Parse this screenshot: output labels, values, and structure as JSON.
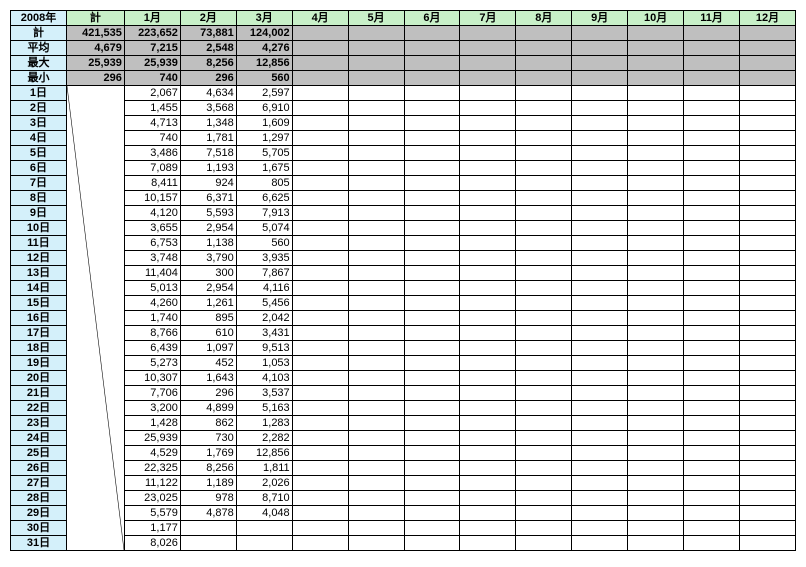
{
  "year_label": "2008年",
  "total_label": "計",
  "months": [
    "1月",
    "2月",
    "3月",
    "4月",
    "5月",
    "6月",
    "7月",
    "8月",
    "9月",
    "10月",
    "11月",
    "12月"
  ],
  "summary_rows": [
    {
      "label": "計",
      "total": "421,535",
      "cells": [
        "223,652",
        "73,881",
        "124,002",
        "",
        "",
        "",
        "",
        "",
        "",
        "",
        "",
        ""
      ]
    },
    {
      "label": "平均",
      "total": "4,679",
      "cells": [
        "7,215",
        "2,548",
        "4,276",
        "",
        "",
        "",
        "",
        "",
        "",
        "",
        "",
        ""
      ]
    },
    {
      "label": "最大",
      "total": "25,939",
      "cells": [
        "25,939",
        "8,256",
        "12,856",
        "",
        "",
        "",
        "",
        "",
        "",
        "",
        "",
        ""
      ]
    },
    {
      "label": "最小",
      "total": "296",
      "cells": [
        "740",
        "296",
        "560",
        "",
        "",
        "",
        "",
        "",
        "",
        "",
        "",
        ""
      ]
    }
  ],
  "day_rows": [
    {
      "label": "1日",
      "cells": [
        "2,067",
        "4,634",
        "2,597",
        "",
        "",
        "",
        "",
        "",
        "",
        "",
        "",
        ""
      ]
    },
    {
      "label": "2日",
      "cells": [
        "1,455",
        "3,568",
        "6,910",
        "",
        "",
        "",
        "",
        "",
        "",
        "",
        "",
        ""
      ]
    },
    {
      "label": "3日",
      "cells": [
        "4,713",
        "1,348",
        "1,609",
        "",
        "",
        "",
        "",
        "",
        "",
        "",
        "",
        ""
      ]
    },
    {
      "label": "4日",
      "cells": [
        "740",
        "1,781",
        "1,297",
        "",
        "",
        "",
        "",
        "",
        "",
        "",
        "",
        ""
      ]
    },
    {
      "label": "5日",
      "cells": [
        "3,486",
        "7,518",
        "5,705",
        "",
        "",
        "",
        "",
        "",
        "",
        "",
        "",
        ""
      ]
    },
    {
      "label": "6日",
      "cells": [
        "7,089",
        "1,193",
        "1,675",
        "",
        "",
        "",
        "",
        "",
        "",
        "",
        "",
        ""
      ]
    },
    {
      "label": "7日",
      "cells": [
        "8,411",
        "924",
        "805",
        "",
        "",
        "",
        "",
        "",
        "",
        "",
        "",
        ""
      ]
    },
    {
      "label": "8日",
      "cells": [
        "10,157",
        "6,371",
        "6,625",
        "",
        "",
        "",
        "",
        "",
        "",
        "",
        "",
        ""
      ]
    },
    {
      "label": "9日",
      "cells": [
        "4,120",
        "5,593",
        "7,913",
        "",
        "",
        "",
        "",
        "",
        "",
        "",
        "",
        ""
      ]
    },
    {
      "label": "10日",
      "cells": [
        "3,655",
        "2,954",
        "5,074",
        "",
        "",
        "",
        "",
        "",
        "",
        "",
        "",
        ""
      ]
    },
    {
      "label": "11日",
      "cells": [
        "6,753",
        "1,138",
        "560",
        "",
        "",
        "",
        "",
        "",
        "",
        "",
        "",
        ""
      ]
    },
    {
      "label": "12日",
      "cells": [
        "3,748",
        "3,790",
        "3,935",
        "",
        "",
        "",
        "",
        "",
        "",
        "",
        "",
        ""
      ]
    },
    {
      "label": "13日",
      "cells": [
        "11,404",
        "300",
        "7,867",
        "",
        "",
        "",
        "",
        "",
        "",
        "",
        "",
        ""
      ]
    },
    {
      "label": "14日",
      "cells": [
        "5,013",
        "2,954",
        "4,116",
        "",
        "",
        "",
        "",
        "",
        "",
        "",
        "",
        ""
      ]
    },
    {
      "label": "15日",
      "cells": [
        "4,260",
        "1,261",
        "5,456",
        "",
        "",
        "",
        "",
        "",
        "",
        "",
        "",
        ""
      ]
    },
    {
      "label": "16日",
      "cells": [
        "1,740",
        "895",
        "2,042",
        "",
        "",
        "",
        "",
        "",
        "",
        "",
        "",
        ""
      ]
    },
    {
      "label": "17日",
      "cells": [
        "8,766",
        "610",
        "3,431",
        "",
        "",
        "",
        "",
        "",
        "",
        "",
        "",
        ""
      ]
    },
    {
      "label": "18日",
      "cells": [
        "6,439",
        "1,097",
        "9,513",
        "",
        "",
        "",
        "",
        "",
        "",
        "",
        "",
        ""
      ]
    },
    {
      "label": "19日",
      "cells": [
        "5,273",
        "452",
        "1,053",
        "",
        "",
        "",
        "",
        "",
        "",
        "",
        "",
        ""
      ]
    },
    {
      "label": "20日",
      "cells": [
        "10,307",
        "1,643",
        "4,103",
        "",
        "",
        "",
        "",
        "",
        "",
        "",
        "",
        ""
      ]
    },
    {
      "label": "21日",
      "cells": [
        "7,706",
        "296",
        "3,537",
        "",
        "",
        "",
        "",
        "",
        "",
        "",
        "",
        ""
      ]
    },
    {
      "label": "22日",
      "cells": [
        "3,200",
        "4,899",
        "5,163",
        "",
        "",
        "",
        "",
        "",
        "",
        "",
        "",
        ""
      ]
    },
    {
      "label": "23日",
      "cells": [
        "1,428",
        "862",
        "1,283",
        "",
        "",
        "",
        "",
        "",
        "",
        "",
        "",
        ""
      ]
    },
    {
      "label": "24日",
      "cells": [
        "25,939",
        "730",
        "2,282",
        "",
        "",
        "",
        "",
        "",
        "",
        "",
        "",
        ""
      ]
    },
    {
      "label": "25日",
      "cells": [
        "4,529",
        "1,769",
        "12,856",
        "",
        "",
        "",
        "",
        "",
        "",
        "",
        "",
        ""
      ]
    },
    {
      "label": "26日",
      "cells": [
        "22,325",
        "8,256",
        "1,811",
        "",
        "",
        "",
        "",
        "",
        "",
        "",
        "",
        ""
      ]
    },
    {
      "label": "27日",
      "cells": [
        "11,122",
        "1,189",
        "2,026",
        "",
        "",
        "",
        "",
        "",
        "",
        "",
        "",
        ""
      ]
    },
    {
      "label": "28日",
      "cells": [
        "23,025",
        "978",
        "8,710",
        "",
        "",
        "",
        "",
        "",
        "",
        "",
        "",
        ""
      ]
    },
    {
      "label": "29日",
      "cells": [
        "5,579",
        "4,878",
        "4,048",
        "",
        "",
        "",
        "",
        "",
        "",
        "",
        "",
        ""
      ]
    },
    {
      "label": "30日",
      "cells": [
        "1,177",
        "",
        "",
        "",
        "",
        "",
        "",
        "",
        "",
        "",
        "",
        ""
      ]
    },
    {
      "label": "31日",
      "cells": [
        "8,026",
        "",
        "",
        "",
        "",
        "",
        "",
        "",
        "",
        "",
        "",
        ""
      ]
    }
  ]
}
